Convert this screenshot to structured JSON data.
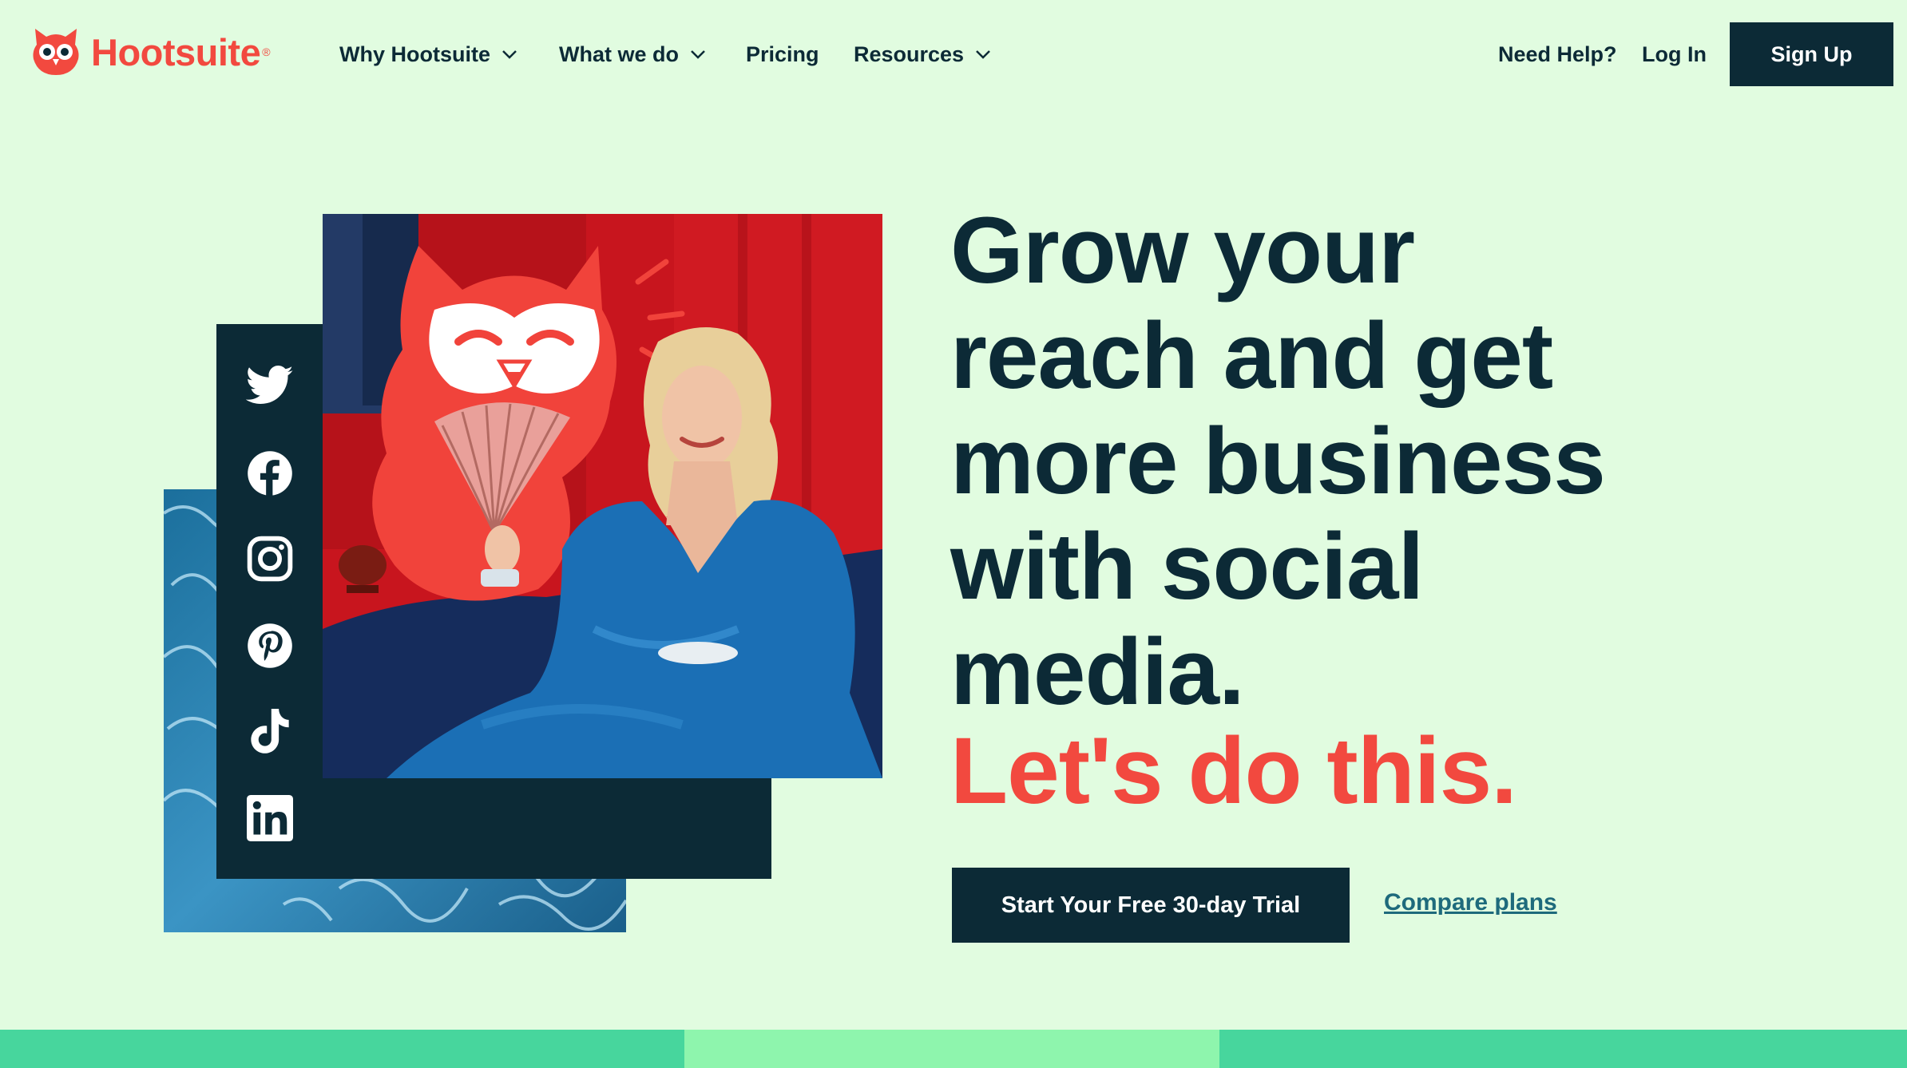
{
  "brand": {
    "name": "Hootsuite",
    "registered_mark": "®",
    "logo_icon": "owl-icon",
    "colors": {
      "primary": "#f2493f",
      "dark": "#0c2a36",
      "background": "#e1fce0",
      "link": "#1e6a7c"
    }
  },
  "nav": {
    "items": [
      {
        "label": "Why Hootsuite",
        "has_dropdown": true,
        "icon": "chevron-down-icon"
      },
      {
        "label": "What we do",
        "has_dropdown": true,
        "icon": "chevron-down-icon"
      },
      {
        "label": "Pricing",
        "has_dropdown": false
      },
      {
        "label": "Resources",
        "has_dropdown": true,
        "icon": "chevron-down-icon"
      }
    ],
    "help_label": "Need Help?",
    "login_label": "Log In",
    "signup_label": "Sign Up"
  },
  "hero": {
    "headline_lines": [
      "Grow your",
      "reach and get",
      "more business",
      "with social",
      "media."
    ],
    "tagline": "Let's do this.",
    "cta_label": "Start Your Free 30-day Trial",
    "secondary_link": "Compare plans",
    "social_icons": [
      "twitter-icon",
      "facebook-icon",
      "instagram-icon",
      "pinterest-icon",
      "tiktok-icon",
      "linkedin-icon"
    ]
  },
  "footer_strips": {
    "colors": [
      "#47d69d",
      "#8ef5ad",
      "#47d69d"
    ]
  }
}
